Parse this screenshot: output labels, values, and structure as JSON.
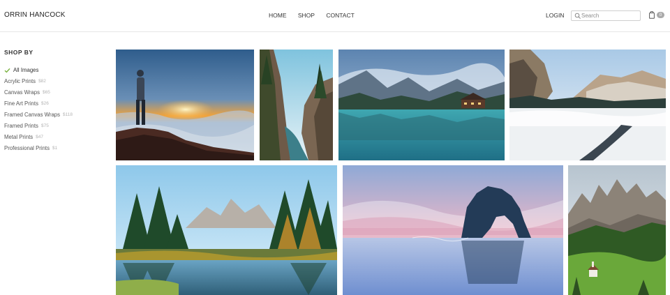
{
  "header": {
    "brand": "ORRIN HANCOCK",
    "nav": [
      "HOME",
      "SHOP",
      "CONTACT"
    ],
    "login": "LOGIN",
    "search_placeholder": "Search",
    "cart_count": "0"
  },
  "sidebar": {
    "title": "SHOP BY",
    "categories": [
      {
        "label": "All Images",
        "count": "",
        "active": true
      },
      {
        "label": "Acrylic Prints",
        "count": "$82"
      },
      {
        "label": "Canvas Wraps",
        "count": "$65"
      },
      {
        "label": "Fine Art Prints",
        "count": "$26"
      },
      {
        "label": "Framed Canvas Wraps",
        "count": "$118"
      },
      {
        "label": "Framed Prints",
        "count": "$75"
      },
      {
        "label": "Metal Prints",
        "count": "$47"
      },
      {
        "label": "Professional Prints",
        "count": "$1"
      }
    ]
  },
  "gallery": [
    {
      "subject": "hiker-sunset-above-clouds"
    },
    {
      "subject": "coastal-rocks-river"
    },
    {
      "subject": "emerald-lake-lodge"
    },
    {
      "subject": "misty-mountain-valley"
    },
    {
      "subject": "teton-forest-reflection"
    },
    {
      "subject": "sea-arch-rock-pastel"
    },
    {
      "subject": "dolomites-chapel-meadow"
    }
  ],
  "colors": {
    "accent_check": "#7cb342",
    "muted_text": "#b4b4b4",
    "border": "#e6e6e6"
  }
}
